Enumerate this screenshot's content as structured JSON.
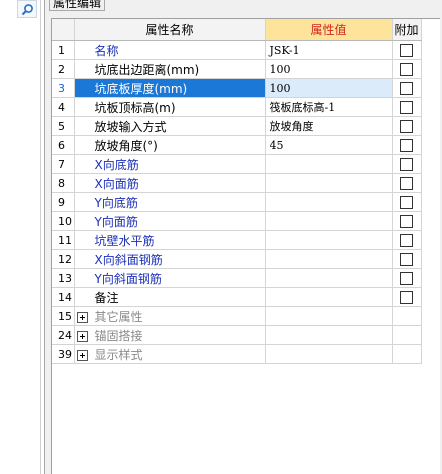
{
  "panel": {
    "tab_label": "属性编辑"
  },
  "grid": {
    "headers": {
      "name": "属性名称",
      "value": "属性值",
      "attach": "附加"
    },
    "rows": [
      {
        "num": "1",
        "name": "名称",
        "value": "JSK-1",
        "attach": false,
        "blue": true,
        "selected": false
      },
      {
        "num": "2",
        "name": "坑底出边距离(mm)",
        "value": "100",
        "attach": false,
        "blue": false,
        "selected": false
      },
      {
        "num": "3",
        "name": "坑底板厚度(mm)",
        "value": "100",
        "attach": false,
        "blue": false,
        "selected": true
      },
      {
        "num": "4",
        "name": "坑板顶标高(m)",
        "value": "筏板底标高-1",
        "attach": false,
        "blue": false,
        "selected": false
      },
      {
        "num": "5",
        "name": "放坡输入方式",
        "value": "放坡角度",
        "attach": false,
        "blue": false,
        "selected": false
      },
      {
        "num": "6",
        "name": "放坡角度(°)",
        "value": "45",
        "attach": false,
        "blue": false,
        "selected": false
      },
      {
        "num": "7",
        "name": "X向底筋",
        "value": "",
        "attach": false,
        "blue": true,
        "selected": false
      },
      {
        "num": "8",
        "name": "X向面筋",
        "value": "",
        "attach": false,
        "blue": true,
        "selected": false
      },
      {
        "num": "9",
        "name": "Y向底筋",
        "value": "",
        "attach": false,
        "blue": true,
        "selected": false
      },
      {
        "num": "10",
        "name": "Y向面筋",
        "value": "",
        "attach": false,
        "blue": true,
        "selected": false
      },
      {
        "num": "11",
        "name": "坑壁水平筋",
        "value": "",
        "attach": false,
        "blue": true,
        "selected": false
      },
      {
        "num": "12",
        "name": "X向斜面钢筋",
        "value": "",
        "attach": false,
        "blue": true,
        "selected": false
      },
      {
        "num": "13",
        "name": "Y向斜面钢筋",
        "value": "",
        "attach": false,
        "blue": true,
        "selected": false
      },
      {
        "num": "14",
        "name": "备注",
        "value": "",
        "attach": false,
        "blue": false,
        "selected": false
      }
    ],
    "groups": [
      {
        "num": "15",
        "name": "其它属性"
      },
      {
        "num": "24",
        "name": "锚固搭接"
      },
      {
        "num": "39",
        "name": "显示样式"
      }
    ]
  },
  "colors": {
    "selected_row_bg": "#1c78d6",
    "selected_value_bg": "#dcebfa",
    "value_header_bg": "#fde49a",
    "value_header_text": "#d1261f",
    "blue_label": "#1b2fb6",
    "group_text": "#8a8a8a"
  },
  "icons": {
    "search": "search-icon"
  }
}
